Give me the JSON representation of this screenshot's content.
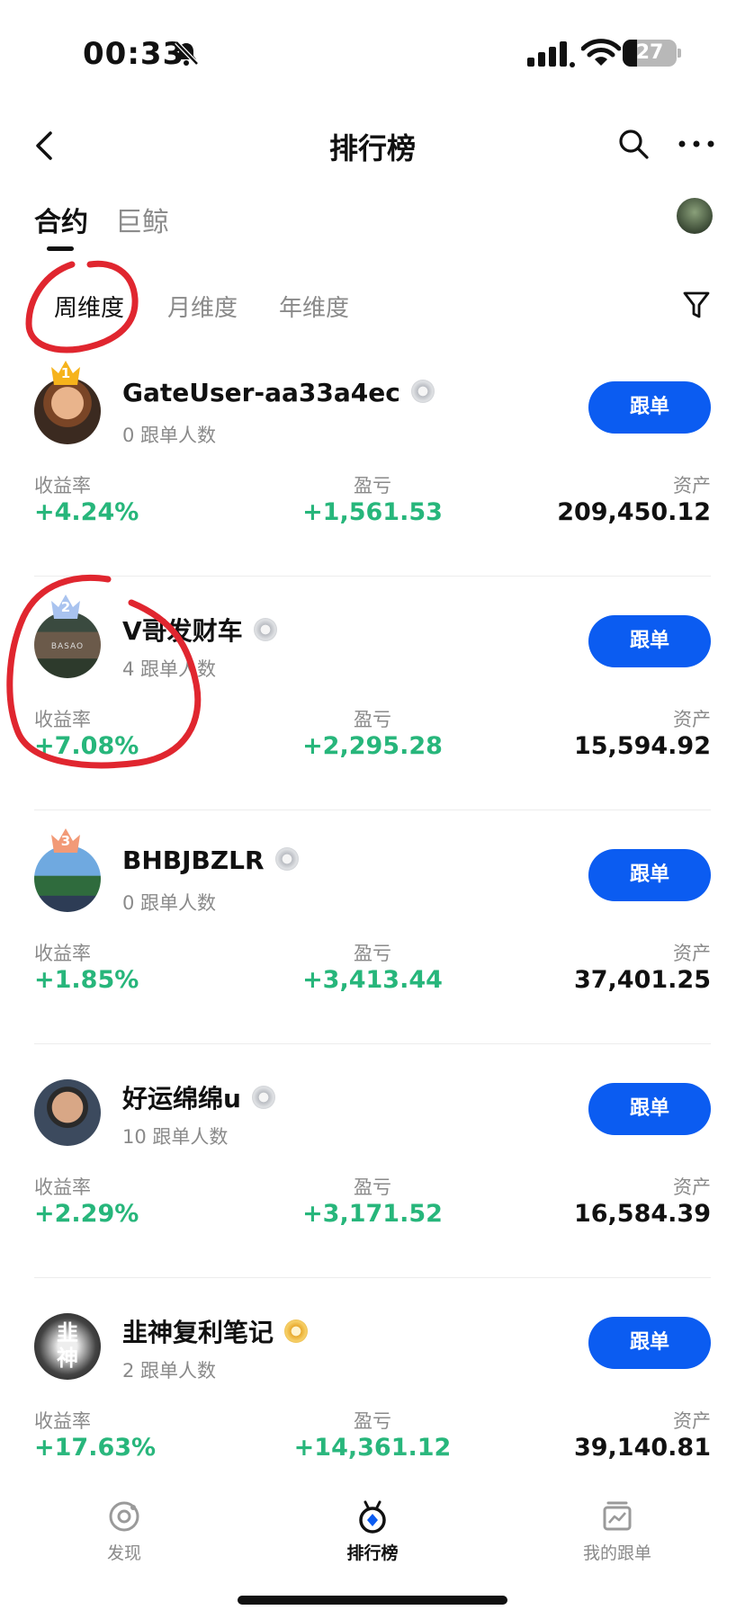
{
  "status_bar": {
    "time": "00:33",
    "battery": "27"
  },
  "header": {
    "title": "排行榜"
  },
  "tabs": [
    {
      "label": "合约"
    },
    {
      "label": "巨鲸"
    }
  ],
  "filters": [
    {
      "label": "周维度"
    },
    {
      "label": "月维度"
    },
    {
      "label": "年维度"
    }
  ],
  "columns": {
    "yield": "收益率",
    "pnl": "盈亏",
    "assets": "资产"
  },
  "follow_label": "跟单",
  "traders": [
    {
      "rank": "1",
      "name": "GateUser-aa33a4ec",
      "followers": "0 跟单人数",
      "yield": "+4.24%",
      "pnl": "+1,561.53",
      "assets": "209,450.12",
      "medal": "silver"
    },
    {
      "rank": "2",
      "name": "V哥发财车",
      "followers": "4 跟单人数",
      "yield": "+7.08%",
      "pnl": "+2,295.28",
      "assets": "15,594.92",
      "medal": "silver"
    },
    {
      "rank": "3",
      "name": "BHBJBZLR",
      "followers": "0 跟单人数",
      "yield": "+1.85%",
      "pnl": "+3,413.44",
      "assets": "37,401.25",
      "medal": "silver"
    },
    {
      "rank": "",
      "name": "好运绵绵u",
      "followers": "10 跟单人数",
      "yield": "+2.29%",
      "pnl": "+3,171.52",
      "assets": "16,584.39",
      "medal": "silver"
    },
    {
      "rank": "",
      "name": "韭神复利笔记",
      "followers": "2 跟单人数",
      "yield": "+17.63%",
      "pnl": "+14,361.12",
      "assets": "39,140.81",
      "medal": "gold"
    }
  ],
  "avatar_texts": {
    "trader2_sign": "BASAO",
    "trader5_glyphs": "韭神"
  },
  "bottom_nav": [
    {
      "label": "发现"
    },
    {
      "label": "排行榜"
    },
    {
      "label": "我的跟单"
    }
  ],
  "colors": {
    "accent": "#0b5cf1",
    "positive": "#27b67b",
    "annotation": "#e0262f"
  }
}
